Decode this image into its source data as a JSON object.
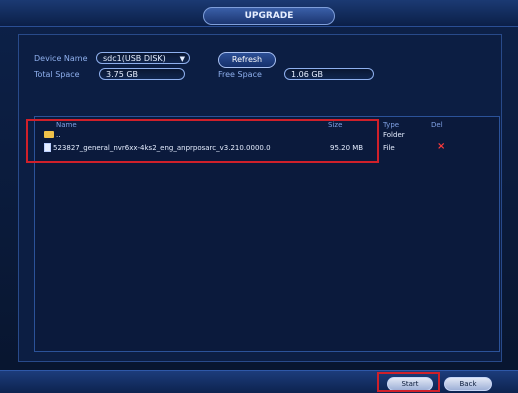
{
  "window": {
    "title": "UPGRADE"
  },
  "device": {
    "name_label": "Device Name",
    "name_value": "sdc1(USB DISK)",
    "total_label": "Total Space",
    "total_value": "3.75 GB",
    "free_label": "Free Space",
    "free_value": "1.06 GB",
    "refresh_label": "Refresh"
  },
  "files": {
    "headers": {
      "name": "Name",
      "size": "Size",
      "type": "Type",
      "del": "Del"
    },
    "rows": [
      {
        "name": "..",
        "size": "",
        "type": "Folder",
        "del": ""
      },
      {
        "name": "523827_general_nvr6xx-4ks2_eng_anprposarc_v3.210.0000.0",
        "size": "95.20 MB",
        "type": "File",
        "del": "×"
      }
    ]
  },
  "buttons": {
    "start": "Start",
    "back": "Back"
  },
  "icons": {
    "folder": "folder-icon",
    "file": "file-icon",
    "delete": "delete-icon"
  },
  "colors": {
    "highlight": "#d0202a",
    "delete": "#ff3b3b"
  }
}
